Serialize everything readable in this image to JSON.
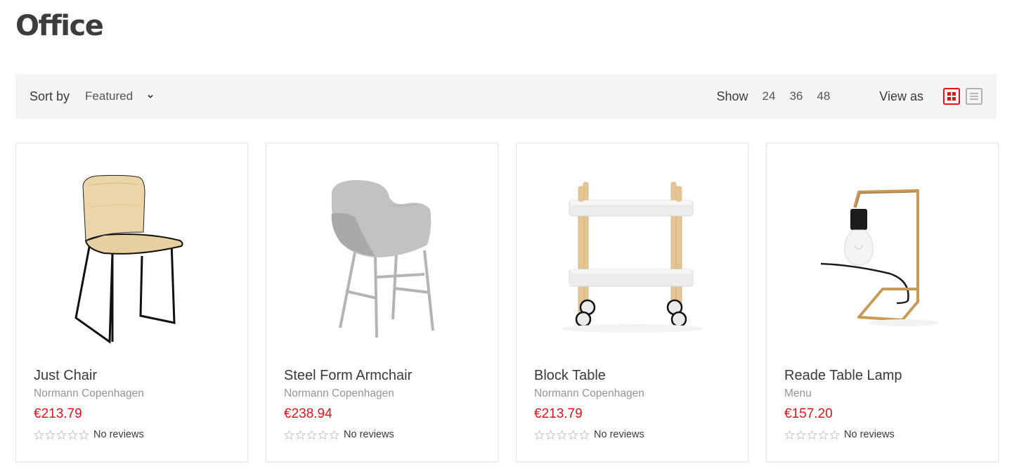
{
  "page": {
    "title": "Office"
  },
  "toolbar": {
    "sort_label": "Sort by",
    "sort_selected": "Featured",
    "show_label": "Show",
    "show_options": [
      "24",
      "36",
      "48"
    ],
    "view_label": "View as",
    "view_modes": [
      {
        "name": "grid",
        "active": true
      },
      {
        "name": "list",
        "active": false
      }
    ]
  },
  "colors": {
    "accent": "#e1141b",
    "toolbar_bg": "#f5f5f5",
    "muted_text": "#959595",
    "inactive_icon": "#b0b0b0"
  },
  "products": [
    {
      "name": "Just Chair",
      "brand": "Normann Copenhagen",
      "price": "€213.79",
      "rating": 0,
      "reviews_text": "No reviews",
      "image": "wooden-chair-black-sled-legs"
    },
    {
      "name": "Steel Form Armchair",
      "brand": "Normann Copenhagen",
      "price": "€238.94",
      "rating": 0,
      "reviews_text": "No reviews",
      "image": "grey-armchair-steel-legs"
    },
    {
      "name": "Block Table",
      "brand": "Normann Copenhagen",
      "price": "€213.79",
      "rating": 0,
      "reviews_text": "No reviews",
      "image": "white-trolley-table-wood-posts"
    },
    {
      "name": "Reade Table Lamp",
      "brand": "Menu",
      "price": "€157.20",
      "rating": 0,
      "reviews_text": "No reviews",
      "image": "brass-table-lamp-bulb"
    }
  ]
}
